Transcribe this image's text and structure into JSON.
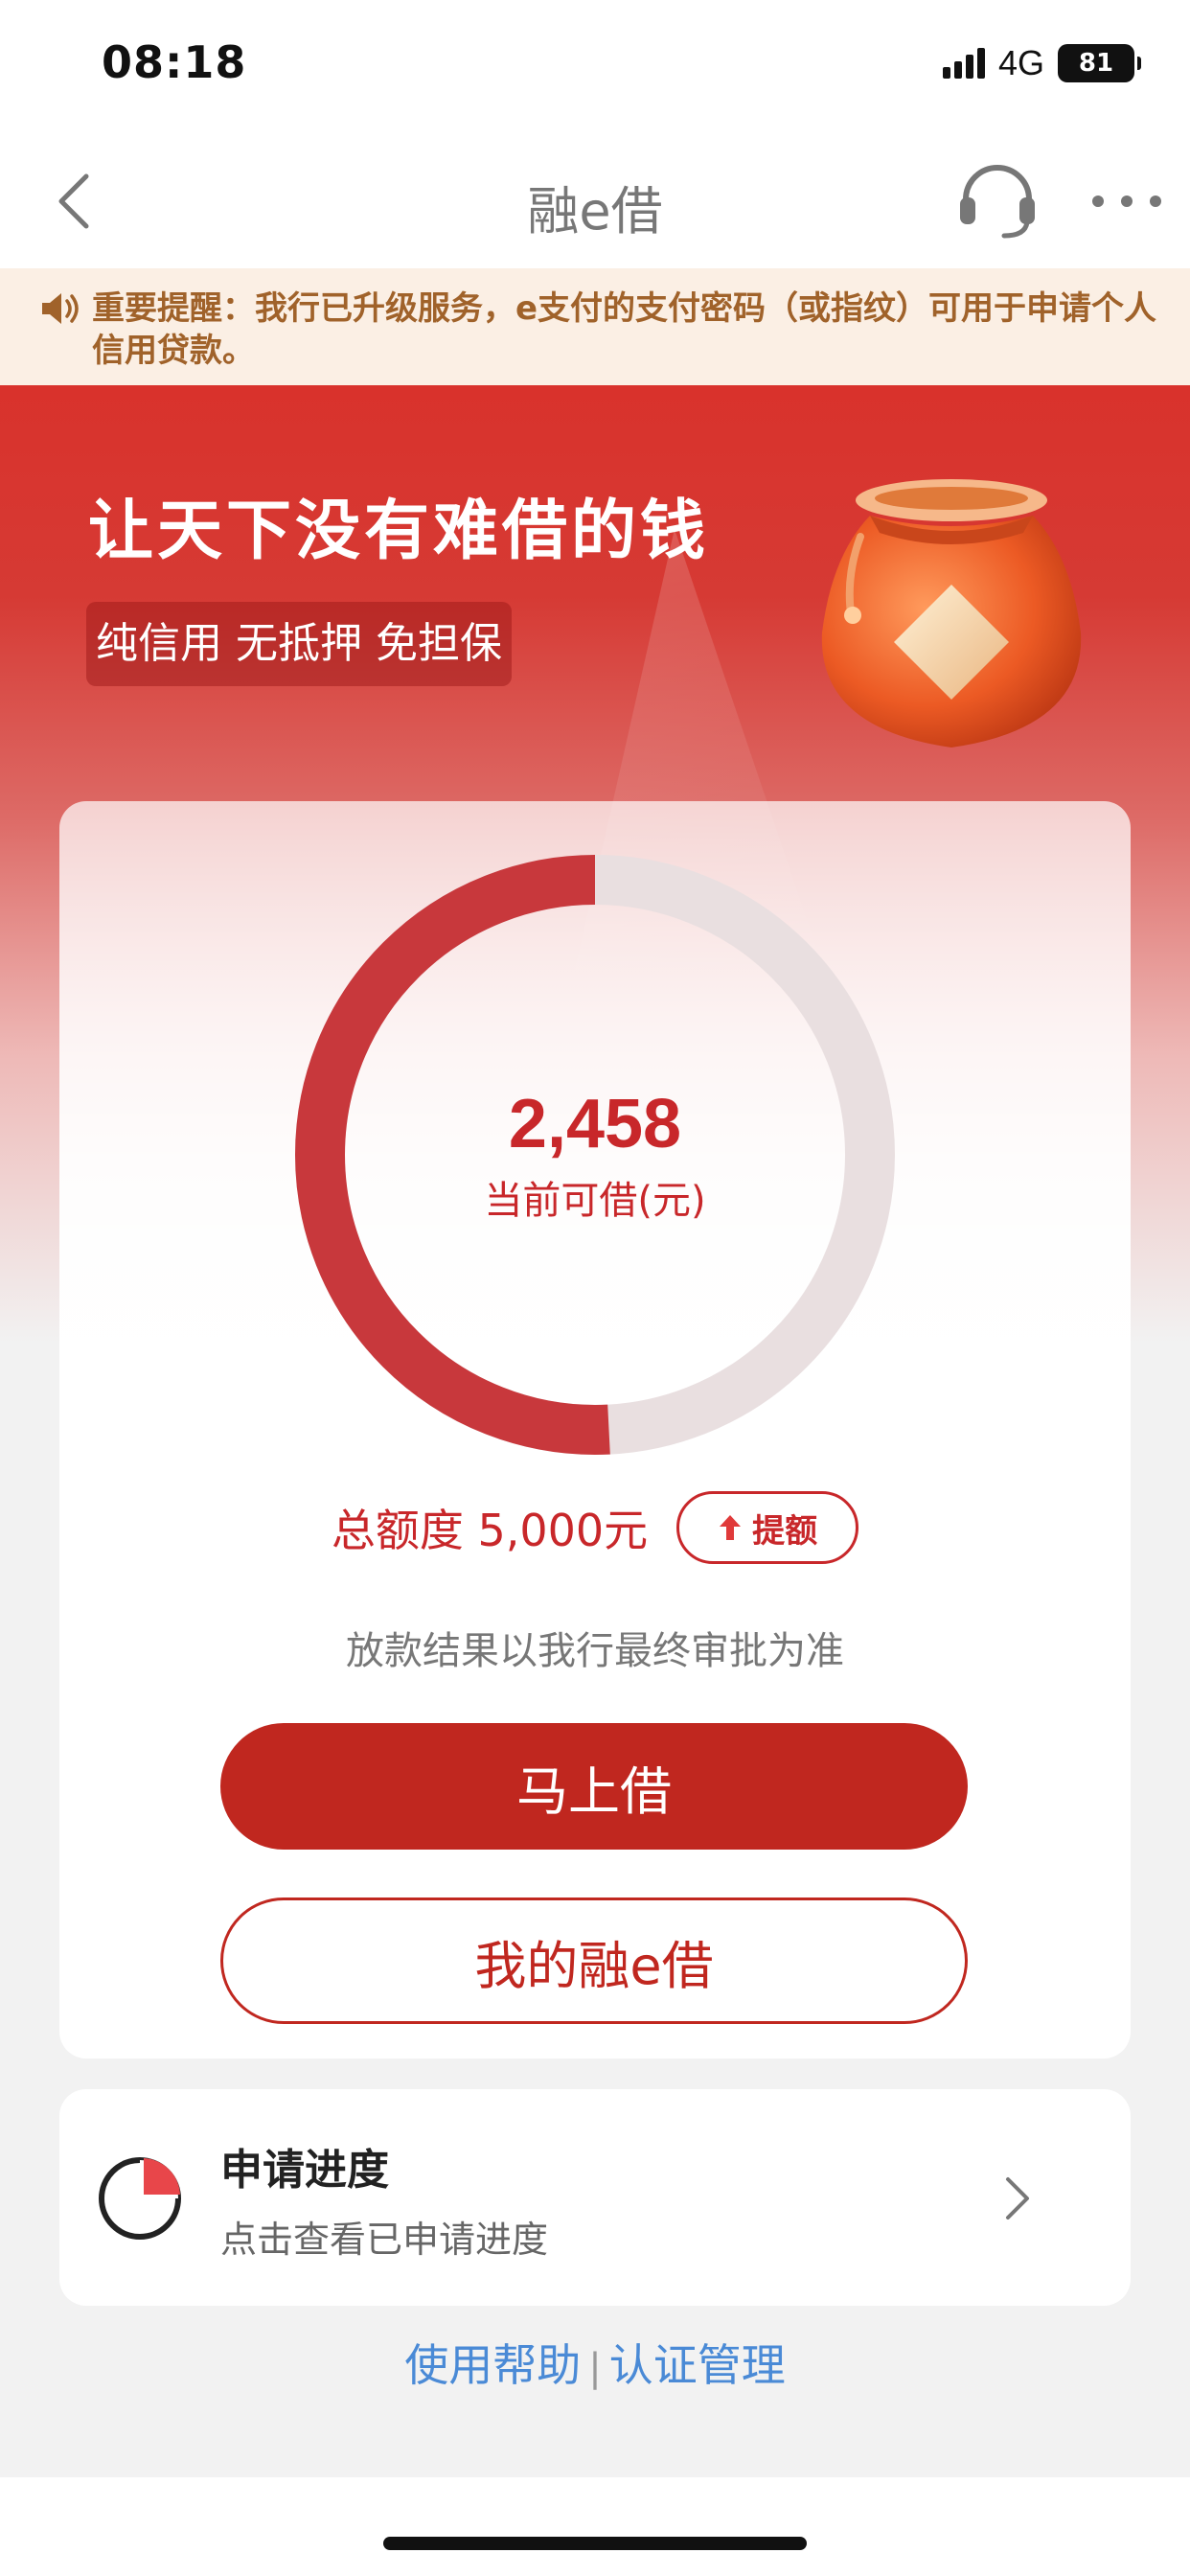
{
  "status_bar": {
    "time": "08:18",
    "network": "4G",
    "battery": "81"
  },
  "nav": {
    "title": "融e借"
  },
  "notice": {
    "text": "重要提醒：我行已升级服务，e支付的支付密码（或指纹）可用于申请个人信用贷款。"
  },
  "hero": {
    "slogan": "让天下没有难借的钱",
    "tags": "纯信用 无抵押 免担保"
  },
  "credit": {
    "available_amount": "2,458",
    "available_label": "当前可借(元)",
    "total_label": "总额度 5,000元",
    "used_fraction": 0.508,
    "raise_label": "提额",
    "disclaimer": "放款结果以我行最终审批为准"
  },
  "actions": {
    "borrow_now": "马上借",
    "my_loan": "我的融e借"
  },
  "progress": {
    "title": "申请进度",
    "subtitle": "点击查看已申请进度"
  },
  "footer": {
    "help": "使用帮助",
    "separator": "|",
    "auth": "认证管理"
  },
  "colors": {
    "brand_red": "#c0271f",
    "ring_red": "#c8383c",
    "ring_track": "#e9dfe0",
    "link_blue": "#4a8ad6"
  }
}
